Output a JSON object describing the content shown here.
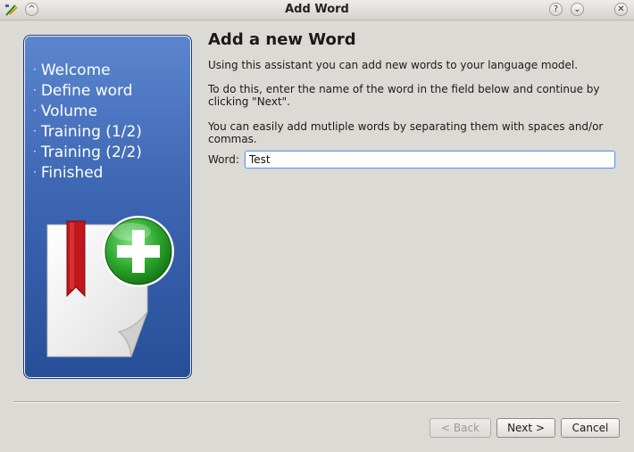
{
  "window": {
    "title": "Add Word",
    "help_glyph": "?",
    "shade_glyph": "⌄",
    "close_glyph": "✕",
    "keep_above_glyph": "^"
  },
  "sidebar": {
    "steps": [
      {
        "label": "Welcome"
      },
      {
        "label": "Define word"
      },
      {
        "label": "Volume"
      },
      {
        "label": "Training (1/2)"
      },
      {
        "label": "Training (2/2)"
      },
      {
        "label": "Finished"
      }
    ],
    "bullet": "·"
  },
  "page": {
    "heading": "Add a new Word",
    "intro": "Using this assistant you can add new words to your language model.",
    "instructions": "To do this, enter the name of the word in the field below and continue by clicking \"Next\".",
    "hint": "You can easily add mutliple words by separating them with spaces and/or commas.",
    "word_label": "Word:",
    "word_value": "Test"
  },
  "buttons": {
    "back": "< Back",
    "next": "Next >",
    "cancel": "Cancel"
  },
  "colors": {
    "panel_top": "#5b86cf",
    "panel_bottom": "#274f99",
    "plus_green": "#2aa52a",
    "bookmark_red": "#c0161c",
    "focus_border": "#6a97d6"
  },
  "icons": [
    "app-icon",
    "keep-above-icon",
    "help-icon",
    "shade-icon",
    "close-icon",
    "add-document-icon"
  ]
}
